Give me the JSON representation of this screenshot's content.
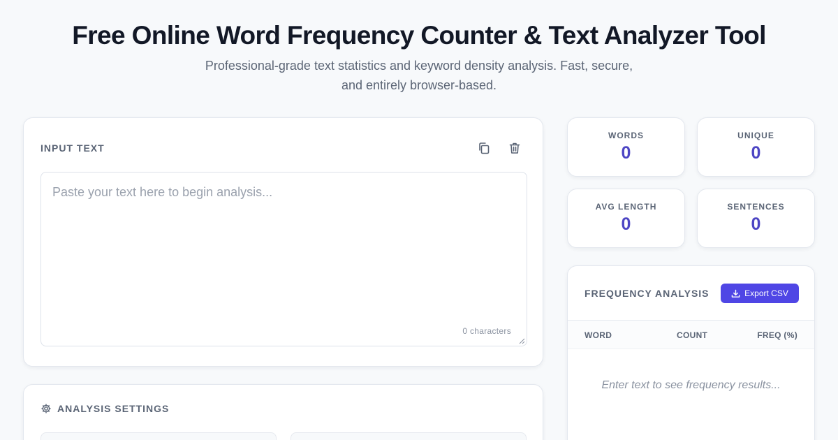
{
  "header": {
    "title": "Free Online Word Frequency Counter & Text Analyzer Tool",
    "subtitle_line1": "Professional-grade text statistics and keyword density analysis. Fast, secure,",
    "subtitle_line2": "and entirely browser-based."
  },
  "input": {
    "label": "INPUT TEXT",
    "placeholder": "Paste your text here to begin analysis...",
    "value": "",
    "char_count": "0 characters",
    "copy_icon": "copy-icon",
    "clear_icon": "trash-icon"
  },
  "settings": {
    "label": "ANALYSIS SETTINGS",
    "icon": "gear-icon"
  },
  "stats": {
    "words": {
      "label": "WORDS",
      "value": "0"
    },
    "unique": {
      "label": "UNIQUE",
      "value": "0"
    },
    "avg_length": {
      "label": "AVG LENGTH",
      "value": "0"
    },
    "sentences": {
      "label": "SENTENCES",
      "value": "0"
    }
  },
  "frequency": {
    "label": "FREQUENCY ANALYSIS",
    "export_label": "Export CSV",
    "export_icon": "download-icon",
    "columns": [
      "WORD",
      "COUNT",
      "FREQ (%)"
    ],
    "rows": [],
    "empty_message": "Enter text to see frequency results..."
  },
  "colors": {
    "accent": "#4f46e5",
    "stat_value": "#4d45c4",
    "background": "#f7f9fb"
  }
}
